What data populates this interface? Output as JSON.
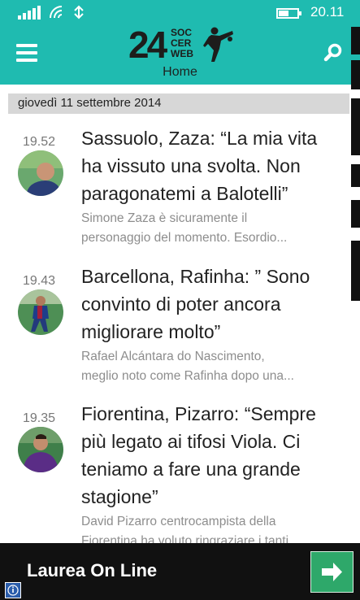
{
  "status_bar": {
    "time": "20.11",
    "battery_level": 0.55,
    "icons": [
      "signal-icon",
      "wifi-icon",
      "data-connection-icon",
      "battery-icon"
    ]
  },
  "header": {
    "logo_number": "24",
    "logo_words": [
      "SOC",
      "CER",
      "WEB"
    ],
    "section": "Home",
    "colors": {
      "bar": "#1fbbb0",
      "logo": "#1d1d1b"
    }
  },
  "date_label": "giovedì 11 settembre 2014",
  "articles": [
    {
      "time": "19.52",
      "headline": "Sassuolo, Zaza: “La mia vita ha vissuto una svolta. Non paragonatemi a Balotelli”",
      "summary": "Simone Zaza è sicuramente il\npersonaggio del momento. Esordio..."
    },
    {
      "time": "19.43",
      "headline": "Barcellona, Rafinha: ” Sono convinto di poter ancora migliorare molto”",
      "summary": "Rafael Alcántara do Nascimento,\nmeglio noto come Rafinha dopo una..."
    },
    {
      "time": "19.35",
      "headline": "Fiorentina, Pizarro: “Sempre più legato ai tifosi Viola. Ci teniamo a fare una grande stagione”",
      "summary": "David Pizarro centrocampista della\nFiorentina ha voluto ringraziare i tanti"
    }
  ],
  "ad": {
    "text": "Laurea On Line",
    "button_icon": "arrow-right-icon",
    "color": "#2ea86a"
  }
}
